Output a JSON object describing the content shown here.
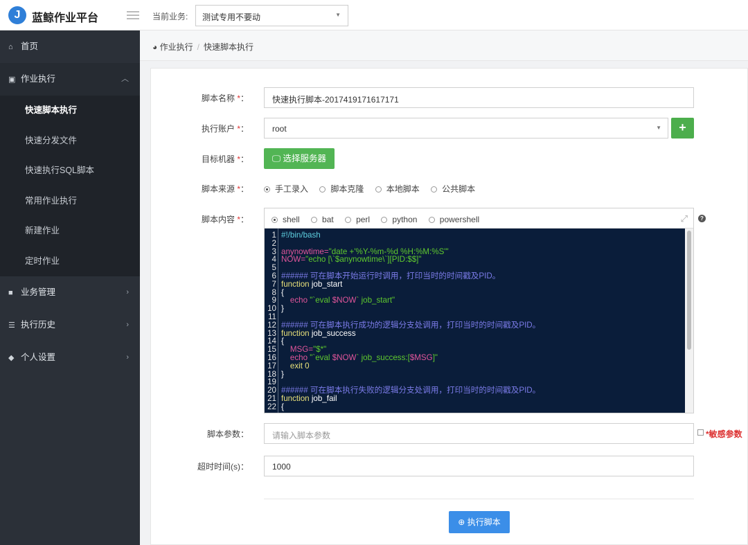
{
  "header": {
    "logo_letter": "J",
    "brand": "蓝鲸作业平台",
    "biz_label": "当前业务:",
    "biz_value": "测试专用不要动"
  },
  "sidebar": {
    "items": [
      {
        "label": "首页",
        "icon": "home-icon"
      },
      {
        "label": "作业执行",
        "icon": "calendar-icon",
        "sub": [
          "快速脚本执行",
          "快速分发文件",
          "快速执行SQL脚本",
          "常用作业执行",
          "新建作业",
          "定时作业"
        ]
      },
      {
        "label": "业务管理",
        "icon": "briefcase-icon"
      },
      {
        "label": "执行历史",
        "icon": "list-icon"
      },
      {
        "label": "个人设置",
        "icon": "shield-icon"
      }
    ]
  },
  "breadcrumb": {
    "parent": "作业执行",
    "current": "快速脚本执行"
  },
  "form": {
    "name_label": "脚本名称",
    "name_value": "快速执行脚本-2017419171617171",
    "account_label": "执行账户",
    "account_value": "root",
    "add_label": "+",
    "target_label": "目标机器",
    "select_server": "选择服务器",
    "source_label": "脚本来源",
    "sources": [
      "手工录入",
      "脚本克隆",
      "本地脚本",
      "公共脚本"
    ],
    "content_label": "脚本内容",
    "langs": [
      "shell",
      "bat",
      "perl",
      "python",
      "powershell"
    ],
    "params_label": "脚本参数",
    "params_placeholder": "请输入脚本参数",
    "sensitive": "*敏感参数",
    "timeout_label": "超时时间(s)",
    "timeout_value": "1000",
    "required": "*",
    "colon": "：",
    "execute": "执行脚本"
  },
  "code": [
    [
      [
        "#!/bin/bash",
        "shebang"
      ]
    ],
    [],
    [
      [
        "anynowtime=",
        "var"
      ],
      [
        "\"date +'%Y-%m-%d %H:%M:%S'\"",
        "str"
      ]
    ],
    [
      [
        "NOW=",
        "var"
      ],
      [
        "\"echo [\\`$anynowtime\\`][PID:$$]\"",
        "str"
      ]
    ],
    [],
    [
      [
        "###### 可在脚本开始运行时调用，打印当时的时间戳及PID。",
        "cm"
      ]
    ],
    [
      [
        "function",
        "kw"
      ],
      [
        " job_start",
        "plain"
      ]
    ],
    [
      [
        "{",
        "plain"
      ]
    ],
    [
      [
        "    echo ",
        "var"
      ],
      [
        "\"`eval ",
        "str"
      ],
      [
        "$NOW",
        "dollar"
      ],
      [
        "` job_start\"",
        "str"
      ]
    ],
    [
      [
        "}",
        "plain"
      ]
    ],
    [],
    [
      [
        "###### 可在脚本执行成功的逻辑分支处调用，打印当时的时间戳及PID。",
        "cm"
      ]
    ],
    [
      [
        "function",
        "kw"
      ],
      [
        " job_success",
        "plain"
      ]
    ],
    [
      [
        "{",
        "plain"
      ]
    ],
    [
      [
        "    MSG=",
        "var"
      ],
      [
        "\"$*\"",
        "str"
      ]
    ],
    [
      [
        "    echo ",
        "var"
      ],
      [
        "\"`eval ",
        "str"
      ],
      [
        "$NOW",
        "dollar"
      ],
      [
        "` job_success:[",
        "str"
      ],
      [
        "$MSG",
        "dollar"
      ],
      [
        "]\"",
        "str"
      ]
    ],
    [
      [
        "    exit 0",
        "kw"
      ]
    ],
    [
      [
        "}",
        "plain"
      ]
    ],
    [],
    [
      [
        "###### 可在脚本执行失败的逻辑分支处调用，打印当时的时间戳及PID。",
        "cm"
      ]
    ],
    [
      [
        "function",
        "kw"
      ],
      [
        " job_fail",
        "plain"
      ]
    ],
    [
      [
        "{",
        "plain"
      ]
    ]
  ]
}
